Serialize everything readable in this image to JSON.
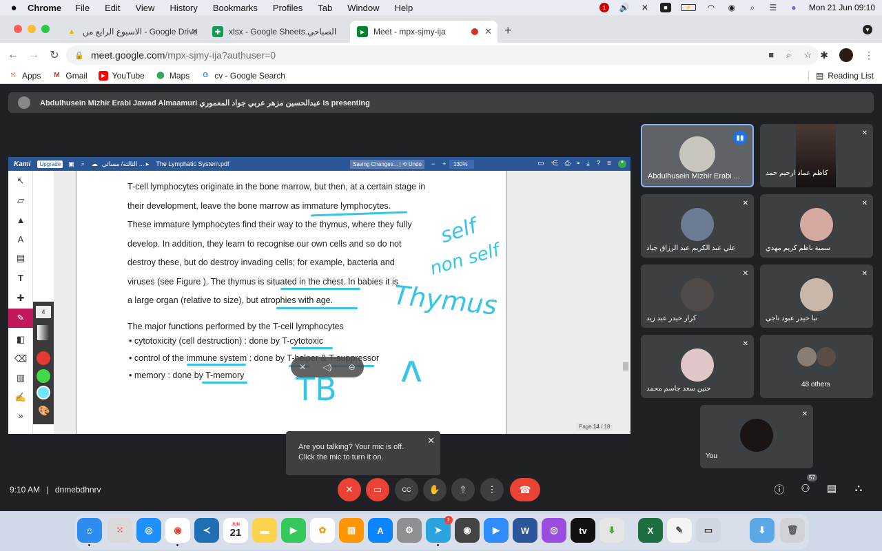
{
  "menubar": {
    "app": "Chrome",
    "items": [
      "File",
      "Edit",
      "View",
      "History",
      "Bookmarks",
      "Profiles",
      "Tab",
      "Window",
      "Help"
    ],
    "clock": "Mon 21 Jun  09:10",
    "notif_badge": "1"
  },
  "tabs": [
    {
      "title": "الاسبوع الرابع من - Google Drive",
      "icon": "drive-icon"
    },
    {
      "title": "xlsx - Google Sheets.الصباحي",
      "icon": "sheets-icon"
    },
    {
      "title": "Meet - mpx-sjmy-ija",
      "icon": "meet-icon",
      "active": true
    }
  ],
  "url": {
    "host": "meet.google.com",
    "path": "/mpx-sjmy-ija?authuser=0"
  },
  "bookmarks": [
    {
      "label": "Apps",
      "icon": "apps-grid-icon"
    },
    {
      "label": "Gmail",
      "icon": "gmail-icon"
    },
    {
      "label": "YouTube",
      "icon": "youtube-icon"
    },
    {
      "label": "Maps",
      "icon": "maps-icon"
    },
    {
      "label": "cv - Google Search",
      "icon": "google-icon"
    }
  ],
  "reading_list": "Reading List",
  "presenting": {
    "text": "Abdulhusein Mizhir Erabi Jawad Almaamuri عبدالحسين مزهر عربي جواد المعموري is presenting"
  },
  "kami": {
    "logo": "Kami",
    "upgrade": "Upgrade",
    "breadcrumb": "الثالثة/ مسائي ... ▸",
    "filename": "The Lymphatic System.pdf",
    "saving": "Saving Changes... | ⟲ Undo",
    "zoom": "130%",
    "stroke_size": "4",
    "page_label": "Page",
    "page_num": "14",
    "page_total": "/ 18"
  },
  "document": {
    "lines": [
      "T-cell lymphocytes originate in the bone marrow, but then, at a certain stage in",
      "their development, leave the bone marrow as immature lymphocytes.",
      "These immature lymphocytes find their way to the thymus, where they fully",
      "develop. In addition, they learn to recognise our own  cells and so do not",
      "destroy these, but do destroy invading cells; for example, bacteria and",
      "viruses  (see Figure ). The thymus is situated in the chest. In babies it is",
      "a large organ (relative to  size), but atrophies with age."
    ],
    "heading": "The major functions performed by the T-cell lymphocytes",
    "bullets": [
      "cytotoxicity (cell destruction) : done by T-cytotoxic",
      "control of the immune system : done by T-helper & T-suppressor",
      "memory : done by T-memory"
    ],
    "handwriting": {
      "self": "self",
      "nonself": "non self",
      "thymus": "Thymus",
      "tb": "TB",
      "lambda": "ʌ"
    }
  },
  "participants": [
    {
      "name": "Abdulhusein Mizhir Erabi ...",
      "role": "presenter"
    },
    {
      "name": "كاظم عماد ارحيم حمد"
    },
    {
      "name": "علي عبد الكريم عبد الرزاق جياد"
    },
    {
      "name": "سمية ناظم كريم مهدي"
    },
    {
      "name": "كرار حيدر عبد زيد"
    },
    {
      "name": "نبأ حيدر عبود ناجي"
    },
    {
      "name": "حنين سعد جاسم محمد"
    },
    {
      "name": "48 others"
    },
    {
      "name": "You"
    }
  ],
  "toast": {
    "line1": "Are you talking? Your mic is off.",
    "line2": "Click the mic to turn it on."
  },
  "meeting": {
    "time": "9:10 AM",
    "separator": "|",
    "code": "dnmebdhnrv",
    "participant_count": "57"
  },
  "dock": {
    "calendar_month": "JUN",
    "calendar_day": "21",
    "telegram_badge": "1"
  }
}
